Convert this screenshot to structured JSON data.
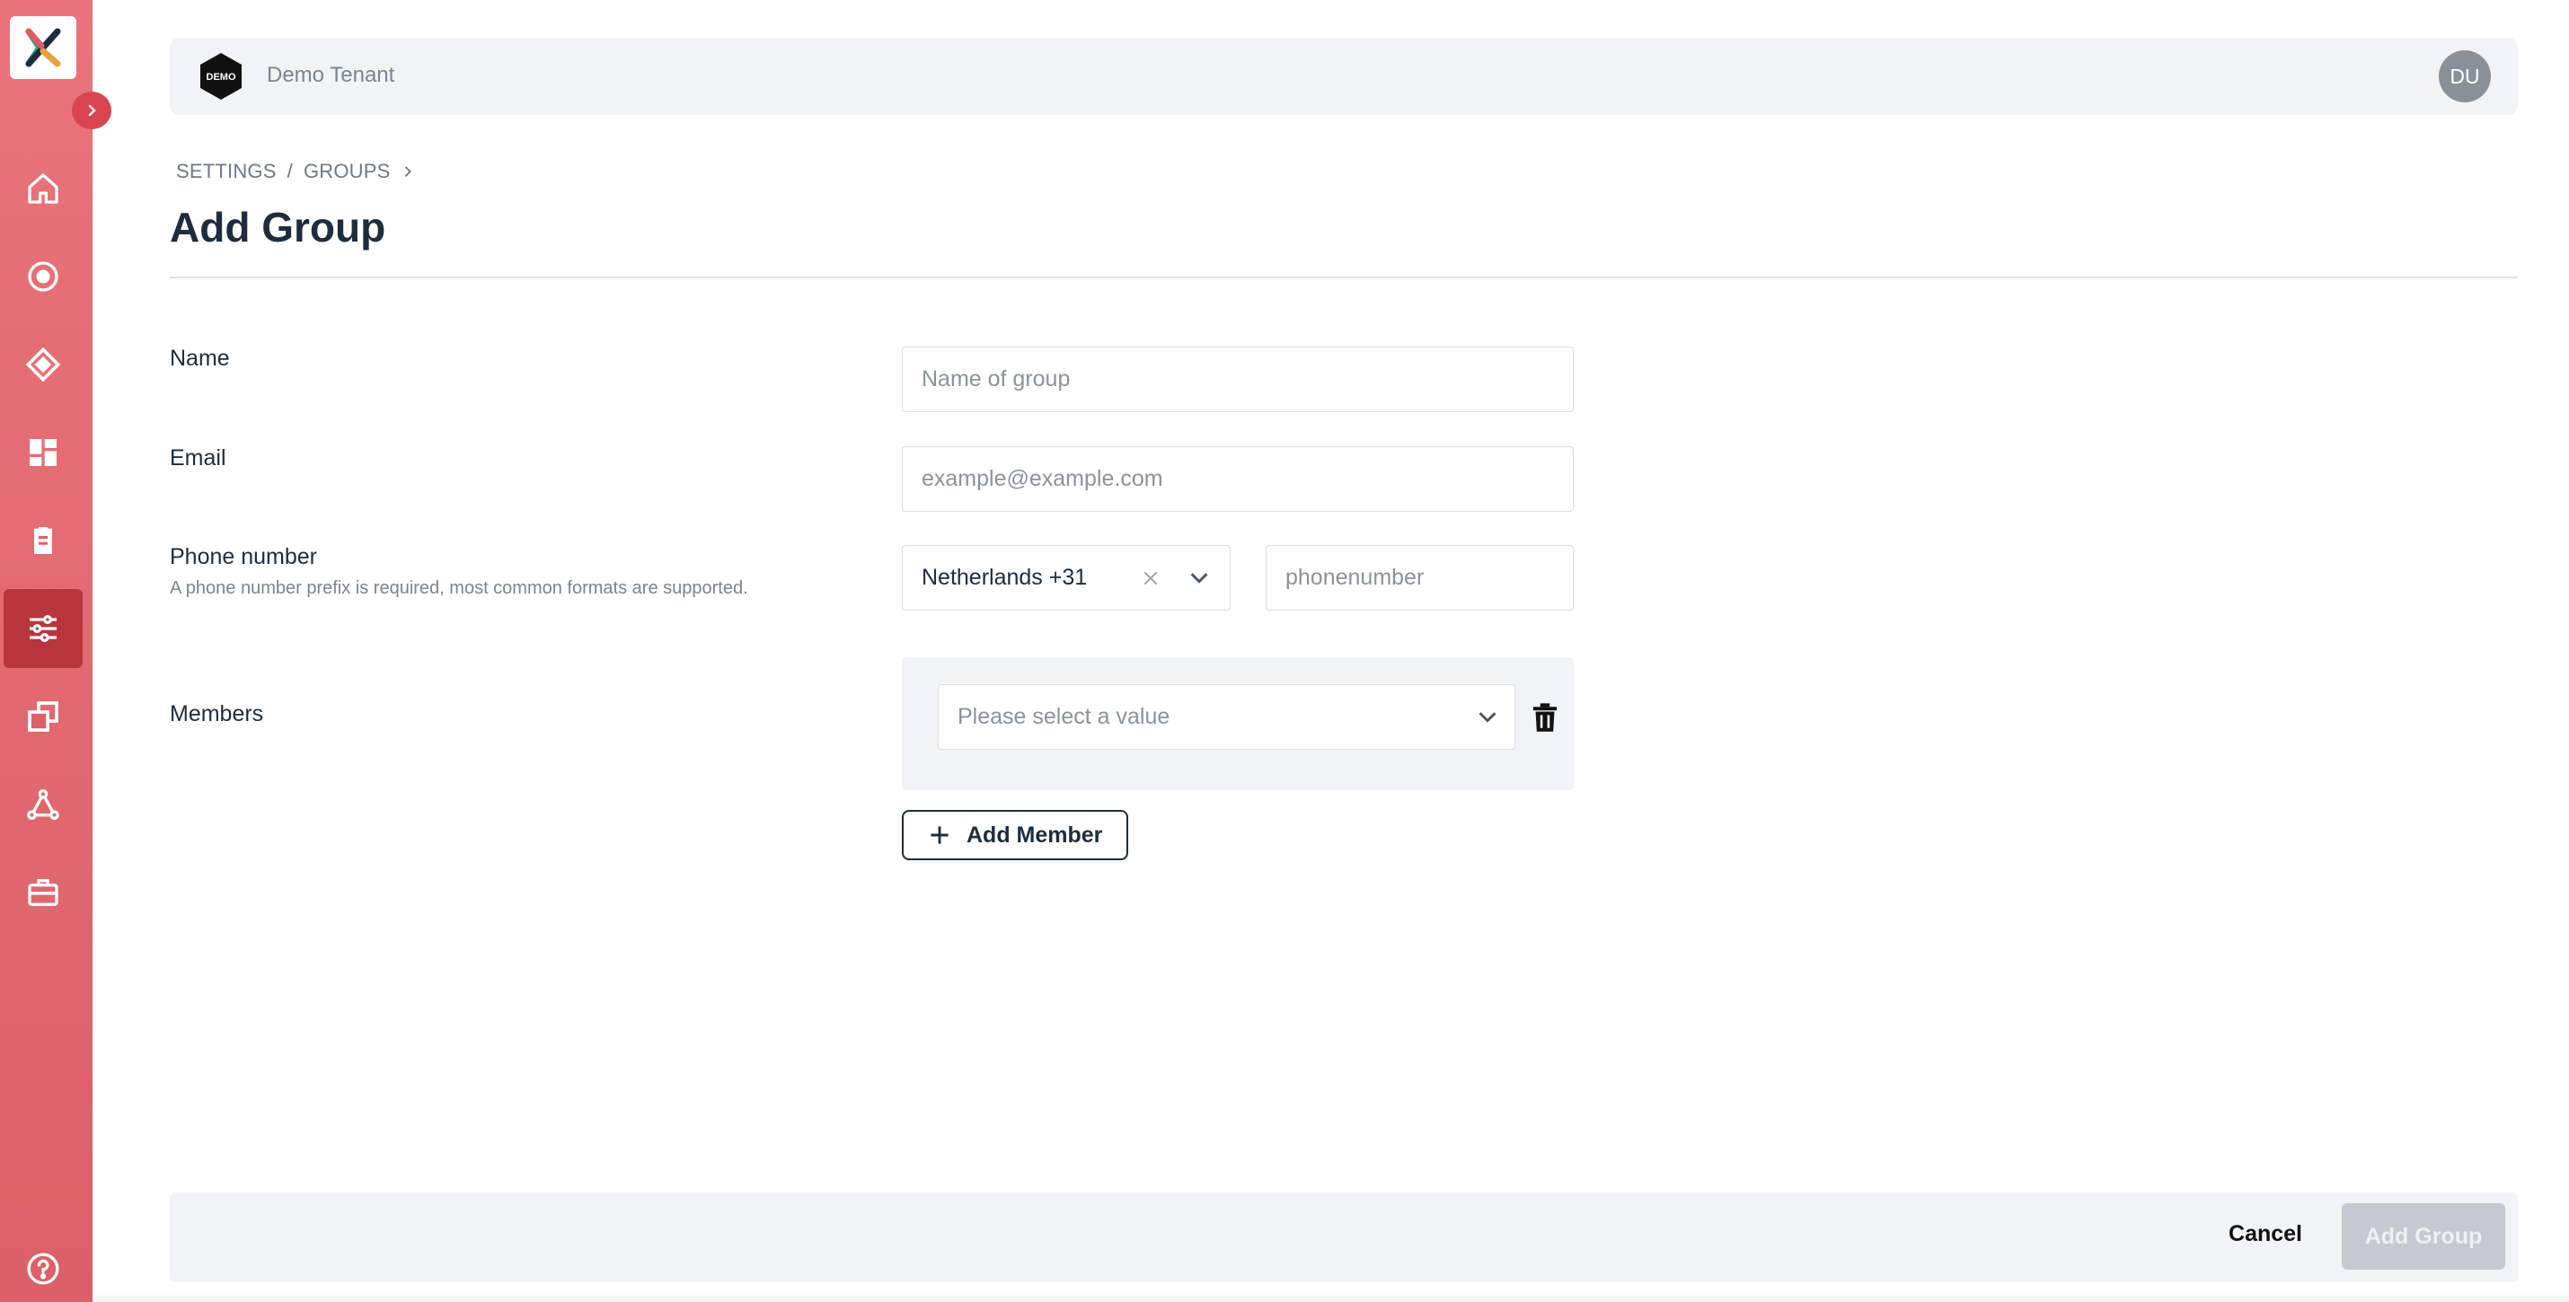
{
  "app": {
    "tenant_badge_text": "DEMO",
    "tenant_name": "Demo Tenant",
    "user_initials": "DU",
    "accent_color": "#dd5f67",
    "active_nav_color": "#b8353e"
  },
  "sidebar": {
    "items": [
      {
        "icon": "home-icon",
        "active": false
      },
      {
        "icon": "target-icon",
        "active": false
      },
      {
        "icon": "diamond-icon",
        "active": false
      },
      {
        "icon": "dashboard-icon",
        "active": false
      },
      {
        "icon": "clipboard-icon",
        "active": false
      },
      {
        "icon": "sliders-icon",
        "active": true
      },
      {
        "icon": "copy-icon",
        "active": false
      },
      {
        "icon": "network-icon",
        "active": false
      },
      {
        "icon": "briefcase-icon",
        "active": false
      }
    ],
    "help_icon": "help-icon"
  },
  "breadcrumb": {
    "items": [
      "SETTINGS",
      "GROUPS"
    ],
    "separator": "/"
  },
  "page": {
    "title": "Add Group"
  },
  "form": {
    "name": {
      "label": "Name",
      "placeholder": "Name of group",
      "value": ""
    },
    "email": {
      "label": "Email",
      "placeholder": "example@example.com",
      "value": ""
    },
    "phone": {
      "label": "Phone number",
      "hint": "A phone number prefix is required, most common formats are supported.",
      "country_value": "Netherlands +31",
      "placeholder": "phonenumber",
      "value": ""
    },
    "members": {
      "label": "Members",
      "select_placeholder": "Please select a value",
      "add_label": "Add Member"
    }
  },
  "footer": {
    "cancel_label": "Cancel",
    "submit_label": "Add Group"
  }
}
